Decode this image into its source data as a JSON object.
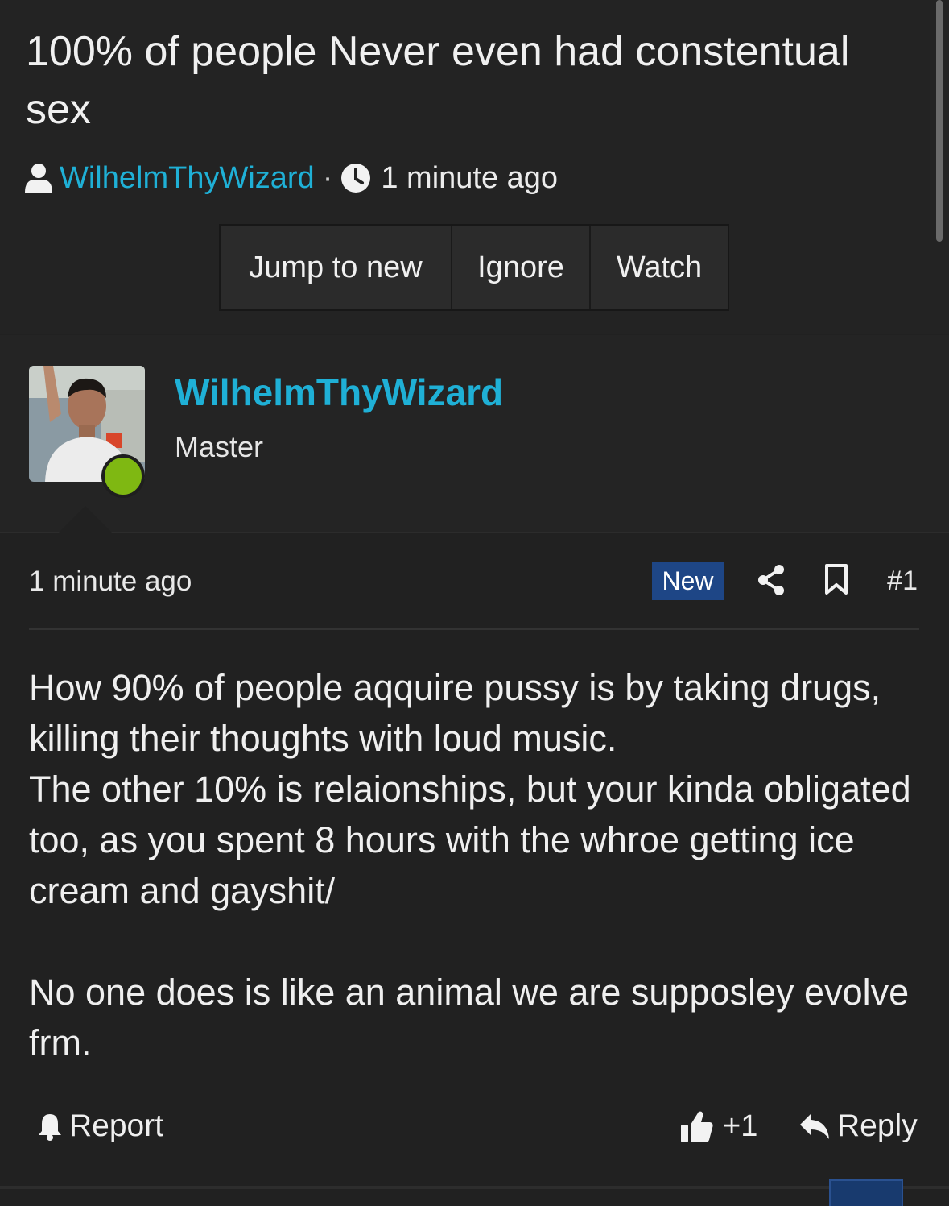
{
  "thread": {
    "title": "100% of people Never even had constentual sex",
    "author": "WilhelmThyWizard",
    "separator": "·",
    "time": "1 minute ago"
  },
  "buttons": {
    "jump_to_new": "Jump to new",
    "ignore": "Ignore",
    "watch": "Watch"
  },
  "post": {
    "username": "WilhelmThyWizard",
    "user_title": "Master",
    "time": "1 minute ago",
    "badge": "New",
    "number": "#1",
    "body": "How 90% of people aqquire pussy is by taking drugs, killing their thoughts with loud music.\nThe other 10% is relaionships, but your kinda obligated too, as you spent 8 hours with the whroe getting ice cream and gayshit/\n\nNo one does is like an animal we are supposley evolve frm.",
    "actions": {
      "report": "Report",
      "reaction": "+1",
      "reply": "Reply"
    }
  },
  "icons": {
    "user": "user-icon",
    "clock": "clock-icon",
    "share": "share-icon",
    "bookmark": "bookmark-icon",
    "bell": "bell-icon",
    "thumb": "thumbs-up-icon",
    "reply": "reply-icon"
  },
  "colors": {
    "link": "#1fb0d6",
    "background": "#212121",
    "new_badge": "#1e4686",
    "online": "#7fb812"
  }
}
